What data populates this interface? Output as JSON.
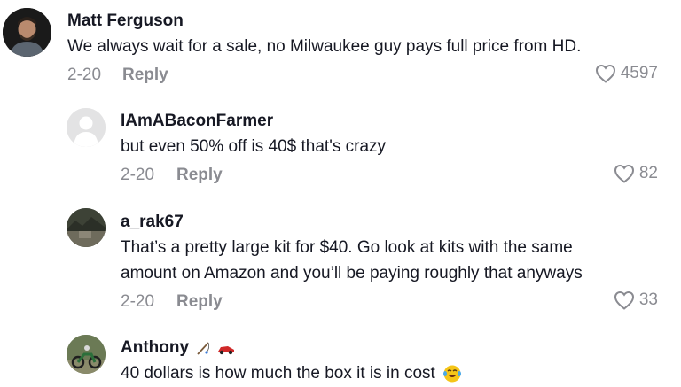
{
  "comments": [
    {
      "username": "Matt Ferguson",
      "text_lines": [
        "We always wait for a sale, no Milwaukee guy pays full price from HD."
      ],
      "date": "2-20",
      "reply": "Reply",
      "likes": "4597",
      "avatar_icon": "person-photo-icon"
    },
    {
      "username": "IAmABaconFarmer",
      "text_lines": [
        "but even 50% off is 40$ that's crazy"
      ],
      "date": "2-20",
      "reply": "Reply",
      "likes": "82",
      "avatar_icon": "default-avatar-icon"
    },
    {
      "username": "a_rak67",
      "text_lines": [
        "That’s a pretty large kit for $40. Go look at kits with the same",
        "amount on Amazon and you’ll be paying roughly that anyways"
      ],
      "date": "2-20",
      "reply": "Reply",
      "likes": "33",
      "avatar_icon": "landscape-photo-icon"
    },
    {
      "username": "Anthony",
      "username_emojis": [
        "fishing-pole-emoji",
        "racing-car-emoji"
      ],
      "text_lines": [
        "40 dollars is how much the box it is in cost"
      ],
      "trailing_emoji": "laughing-crying-emoji",
      "avatar_icon": "dirt-bike-photo-icon"
    }
  ],
  "colors": {
    "text": "#161823",
    "secondary": "#8a8b91",
    "background": "#ffffff"
  }
}
